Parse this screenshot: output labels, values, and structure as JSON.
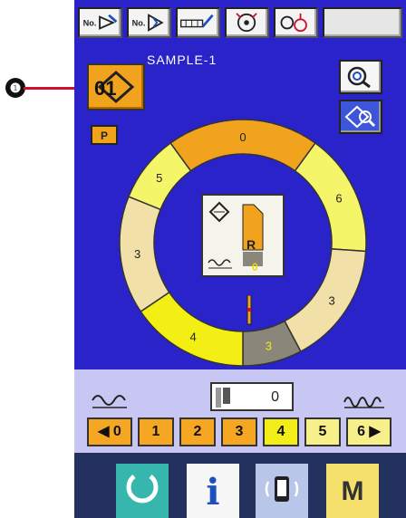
{
  "callout": {
    "number": "❶"
  },
  "toolbar": {
    "buttons": [
      {
        "label": "No.",
        "icon": "program-no-edit-icon"
      },
      {
        "label": "No.",
        "icon": "program-no-select-icon"
      },
      {
        "label": "",
        "icon": "pattern-edit-icon"
      },
      {
        "label": "",
        "icon": "reel-icon"
      },
      {
        "label": "",
        "icon": "counter-reset-icon"
      },
      {
        "label": "",
        "icon": "blank"
      }
    ]
  },
  "program": {
    "number": "01",
    "name": "SAMPLE-1"
  },
  "folder_label": "P",
  "side_buttons": [
    {
      "icon": "zoom-search-icon"
    },
    {
      "icon": "program-search-icon"
    }
  ],
  "ring": {
    "segments": [
      {
        "label": "0",
        "color": "#f2a31e"
      },
      {
        "label": "6",
        "color": "#f5f56a"
      },
      {
        "label": "3",
        "color": "#f1e0a8"
      },
      {
        "label": "3",
        "color": "#8a877a"
      },
      {
        "label": "4",
        "color": "#f3ef14"
      },
      {
        "label": "3",
        "color": "#f1e0a8"
      },
      {
        "label": "5",
        "color": "#f5f56a"
      }
    ]
  },
  "center_icon": {
    "r": "R",
    "count": "0"
  },
  "counter": {
    "value": "0"
  },
  "steps": [
    {
      "label": "◀ 0",
      "style": "orange"
    },
    {
      "label": "1",
      "style": "orange"
    },
    {
      "label": "2",
      "style": "orange"
    },
    {
      "label": "3",
      "style": "orange"
    },
    {
      "label": "4",
      "style": "yellow"
    },
    {
      "label": "5",
      "style": "light"
    },
    {
      "label": "6 ▶",
      "style": "light"
    }
  ],
  "footer": {
    "buttons": [
      {
        "icon": "ready-icon"
      },
      {
        "label": "i",
        "icon": "info-icon"
      },
      {
        "icon": "communication-icon"
      },
      {
        "label": "M",
        "icon": "mode-icon"
      }
    ]
  },
  "colors": {
    "panel_bg": "#2a23c9",
    "orange": "#f2a31e",
    "yellow": "#f3ee1a",
    "light_yellow": "#f7f08a",
    "callout_line": "#d0102a"
  }
}
